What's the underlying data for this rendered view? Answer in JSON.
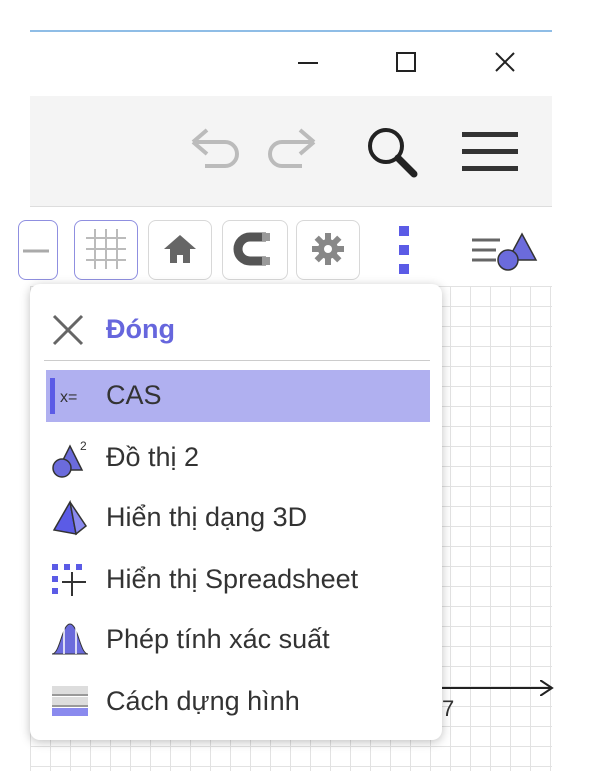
{
  "window": {
    "controls": [
      "minimize-icon",
      "maximize-icon",
      "close-icon"
    ]
  },
  "toolbar": {
    "icons": [
      "undo-icon",
      "redo-icon",
      "search-icon",
      "hamburger-menu-icon"
    ]
  },
  "style_bar": {
    "icons": [
      "grid-icon",
      "home-icon",
      "magnet-icon",
      "gear-icon",
      "more-vertical-icon",
      "views-icon"
    ]
  },
  "graphics": {
    "tick_label": "7"
  },
  "dropdown": {
    "close_label": "Đóng",
    "items": [
      {
        "label": "CAS",
        "icon": "cas-icon",
        "selected": true
      },
      {
        "label": "Đồ thị 2",
        "icon": "graphics2-icon"
      },
      {
        "label": "Hiển thị dạng 3D",
        "icon": "3d-view-icon"
      },
      {
        "label": "Hiển thị Spreadsheet",
        "icon": "spreadsheet-icon"
      },
      {
        "label": "Phép tính xác suất",
        "icon": "probability-icon"
      },
      {
        "label": "Cách dựng hình",
        "icon": "construction-protocol-icon"
      }
    ]
  },
  "colors": {
    "accent": "#6666dd",
    "selected_bg": "#b0b0f0"
  }
}
